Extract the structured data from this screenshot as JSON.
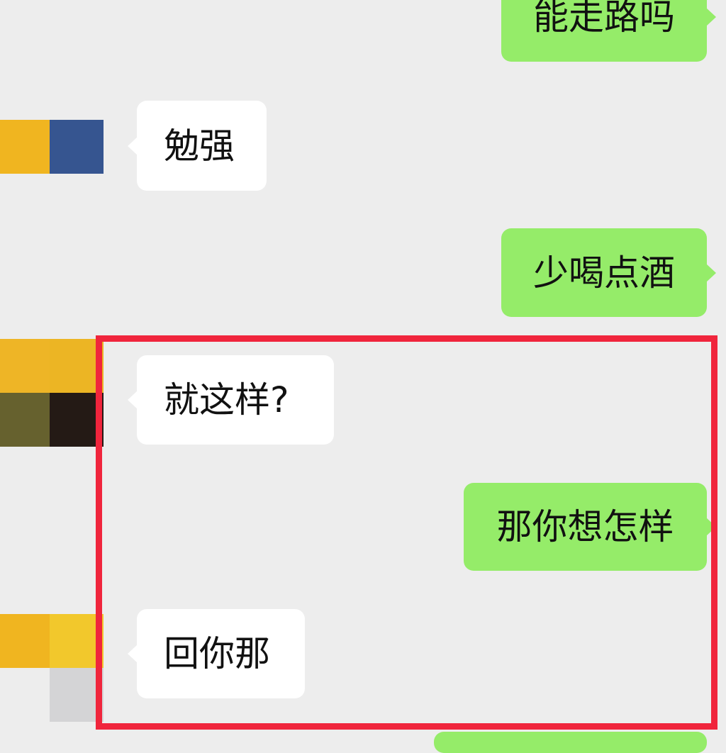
{
  "messages": [
    {
      "side": "sent",
      "text": "能走路吗"
    },
    {
      "side": "received",
      "text": "勉强"
    },
    {
      "side": "sent",
      "text": "少喝点酒"
    },
    {
      "side": "received",
      "text": "就这样?"
    },
    {
      "side": "sent",
      "text": "那你想怎样"
    },
    {
      "side": "received",
      "text": "回你那"
    }
  ],
  "colors": {
    "background": "#ededed",
    "sent_bubble": "#95ec69",
    "received_bubble": "#ffffff",
    "highlight_border": "#f0253c"
  },
  "avatars": [
    {
      "name": "mosaic-avatar-1",
      "pixels": [
        "#f0b520",
        "#365590",
        "#ededed",
        "#ededed"
      ]
    },
    {
      "name": "mosaic-avatar-2",
      "pixels": [
        "#eeb526",
        "#ecb524",
        "#66612e",
        "#241a15"
      ]
    },
    {
      "name": "mosaic-avatar-3",
      "pixels": [
        "#f0b520",
        "#f2c82c",
        "#ededed",
        "#d4d4d6"
      ]
    }
  ]
}
